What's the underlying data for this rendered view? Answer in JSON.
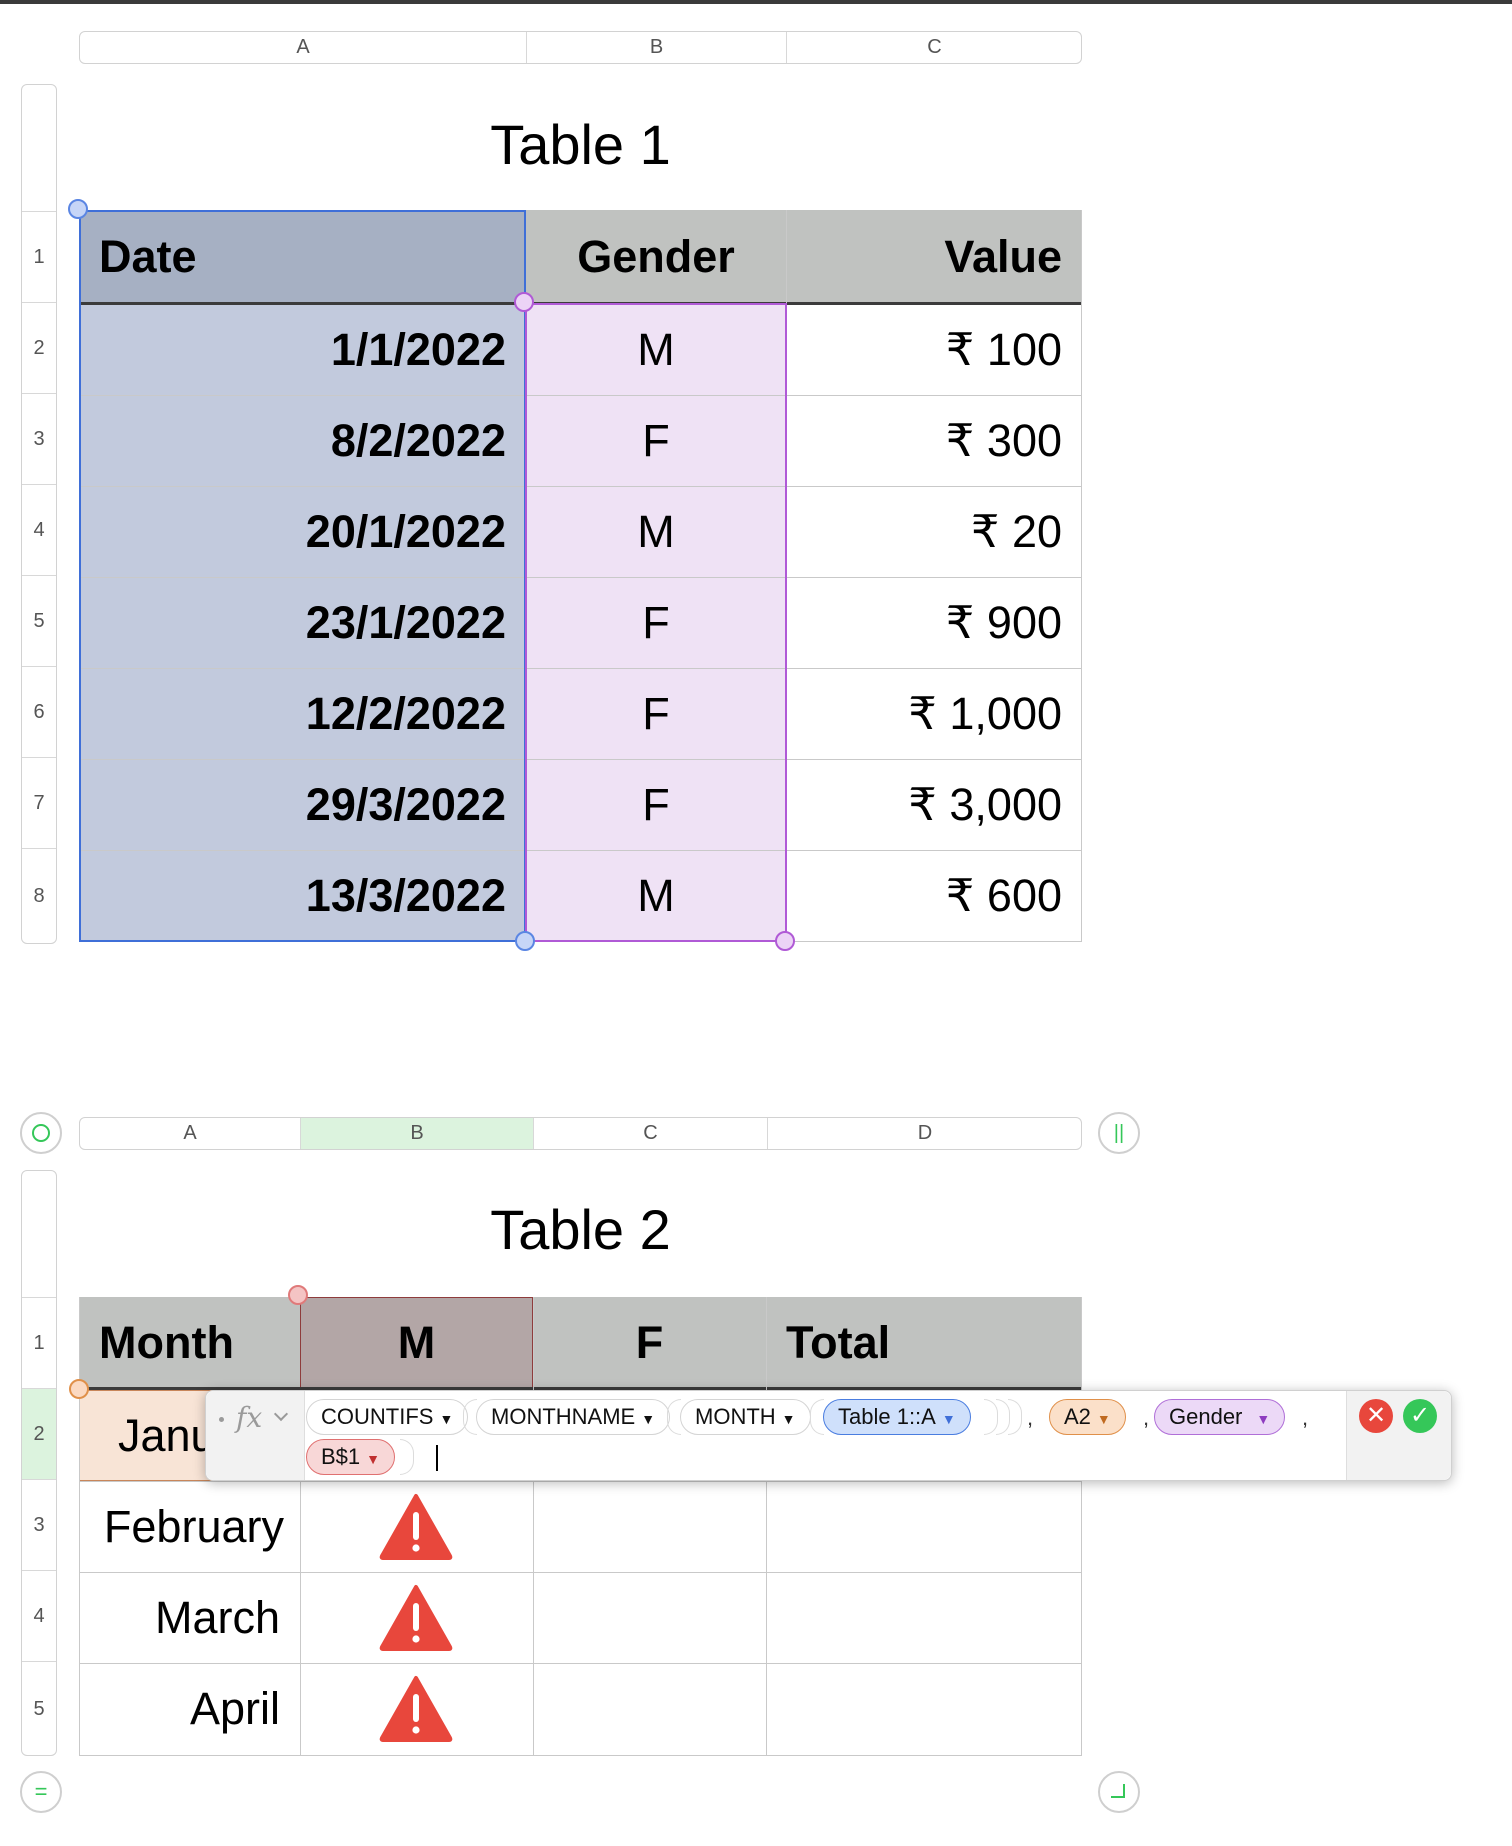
{
  "table1": {
    "title": "Table 1",
    "columns": [
      "A",
      "B",
      "C"
    ],
    "row_numbers": [
      "1",
      "2",
      "3",
      "4",
      "5",
      "6",
      "7",
      "8"
    ],
    "headers": {
      "date": "Date",
      "gender": "Gender",
      "value": "Value"
    },
    "rows": [
      {
        "date": "1/1/2022",
        "gender": "M",
        "value": "₹ 100"
      },
      {
        "date": "8/2/2022",
        "gender": "F",
        "value": "₹ 300"
      },
      {
        "date": "20/1/2022",
        "gender": "M",
        "value": "₹ 20"
      },
      {
        "date": "23/1/2022",
        "gender": "F",
        "value": "₹ 900"
      },
      {
        "date": "12/2/2022",
        "gender": "F",
        "value": "₹ 1,000"
      },
      {
        "date": "29/3/2022",
        "gender": "F",
        "value": "₹ 3,000"
      },
      {
        "date": "13/3/2022",
        "gender": "M",
        "value": "₹ 600"
      }
    ]
  },
  "table2": {
    "title": "Table 2",
    "columns": [
      "A",
      "B",
      "C",
      "D"
    ],
    "row_numbers": [
      "1",
      "2",
      "3",
      "4",
      "5"
    ],
    "headers": {
      "month": "Month",
      "m": "M",
      "f": "F",
      "total": "Total"
    },
    "rows": [
      {
        "month": "Janu"
      },
      {
        "month": "February",
        "m_status": "error"
      },
      {
        "month": "March",
        "m_status": "error"
      },
      {
        "month": "April",
        "m_status": "error"
      }
    ]
  },
  "formula": {
    "fx_label": "fx",
    "tokens": {
      "countifs": "COUNTIFS",
      "monthname": "MONTHNAME",
      "month": "MONTH",
      "range": "Table 1::A",
      "a2": "A2",
      "gender": "Gender",
      "b1": "B$1"
    },
    "comma": ","
  },
  "colors": {
    "date_col": "#c2cadd",
    "gender_col": "#efe2f5",
    "header_gray": "#c0c2c0",
    "error": "#e8473c",
    "confirm": "#35c759",
    "cancel": "#e8473c"
  }
}
